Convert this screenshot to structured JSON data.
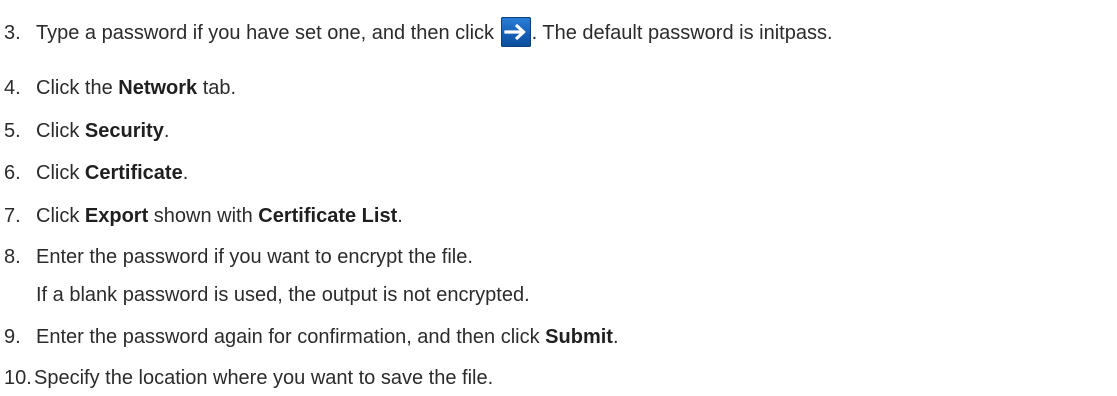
{
  "steps": [
    {
      "num": "3.",
      "pre": "Type a password if you have set one, and then click",
      "icon": "right-arrow-icon",
      "post": ". The default password is initpass."
    },
    {
      "num": "4.",
      "pre": "Click the ",
      "bold": "Network",
      "post": " tab."
    },
    {
      "num": "5.",
      "pre": "Click ",
      "bold": "Security",
      "post": "."
    },
    {
      "num": "6.",
      "pre": "Click ",
      "bold": "Certificate",
      "post": "."
    },
    {
      "num": "7.",
      "pre": "Click ",
      "bold": "Export",
      "mid": " shown with ",
      "bold2": "Certificate List",
      "post": "."
    },
    {
      "num": "8.",
      "pre": "Enter the password if you want to encrypt the file.",
      "continuation": "If a blank password is used, the output is not encrypted."
    },
    {
      "num": "9.",
      "pre": "Enter the password again for confirmation, and then click ",
      "bold": "Submit",
      "post": "."
    },
    {
      "num": "10.",
      "pre": "Specify the location where you want to save the file."
    }
  ],
  "colors": {
    "text": "#2b2b2b",
    "button_blue": "#1560b8"
  }
}
